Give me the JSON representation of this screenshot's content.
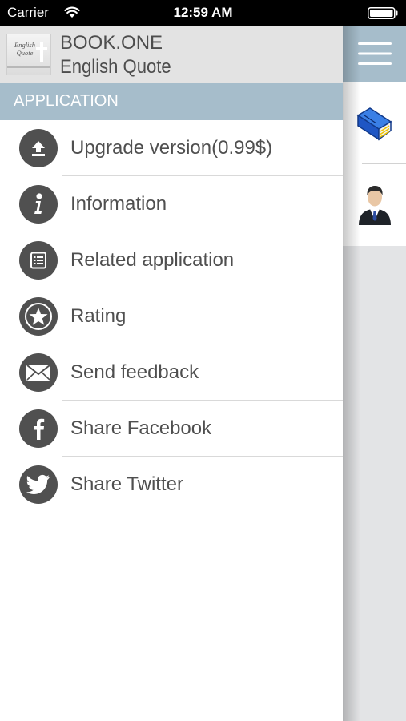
{
  "status_bar": {
    "carrier": "Carrier",
    "time": "12:59 AM"
  },
  "drawer": {
    "logo_text": "English Quote",
    "title": "BOOK.ONE",
    "subtitle": "English Quote",
    "section_header": "APPLICATION",
    "items": [
      {
        "label": "Upgrade version(0.99$)",
        "icon": "upload-icon"
      },
      {
        "label": "Information",
        "icon": "info-icon"
      },
      {
        "label": "Related application",
        "icon": "list-icon"
      },
      {
        "label": "Rating",
        "icon": "star-icon"
      },
      {
        "label": "Send feedback",
        "icon": "envelope-icon"
      },
      {
        "label": "Share Facebook",
        "icon": "facebook-icon"
      },
      {
        "label": "Share Twitter",
        "icon": "twitter-icon"
      }
    ]
  },
  "right_panel": {
    "icons": [
      "hamburger-menu-icon",
      "book-icon",
      "user-icon"
    ]
  },
  "colors": {
    "accent": "#a6bdcb",
    "icon_circle": "#505050",
    "text": "#4f4f4f",
    "header_bg": "#e3e3e3"
  }
}
